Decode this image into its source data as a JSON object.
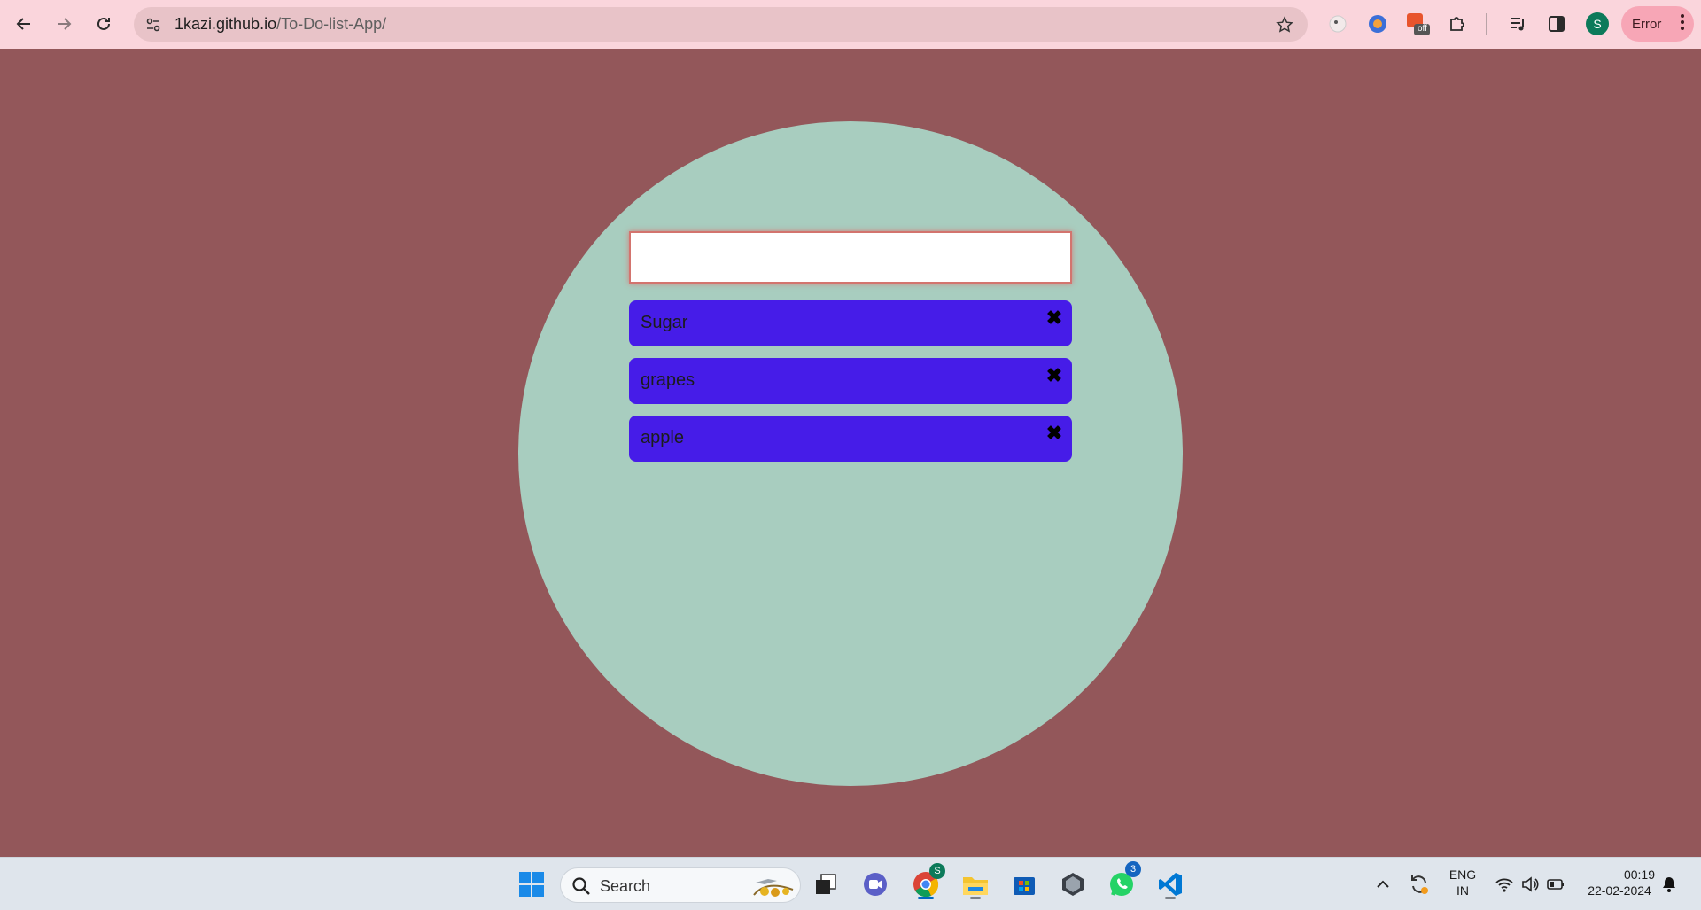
{
  "browser": {
    "url_host": "1kazi.github.io",
    "url_path": "/To-Do-list-App/",
    "profile_initial": "S",
    "error_label": "Error",
    "extensions": [
      "extension-icon",
      "chrome-extension-icon",
      "off-extension-icon",
      "puzzle-icon"
    ],
    "off_badge": "off"
  },
  "app": {
    "input": {
      "value": "",
      "placeholder": ""
    },
    "todos": [
      {
        "label": "Sugar",
        "remove_glyph": "✖"
      },
      {
        "label": "grapes",
        "remove_glyph": "✖"
      },
      {
        "label": "apple",
        "remove_glyph": "✖"
      }
    ],
    "colors": {
      "page_background": "#93575a",
      "circle": "#a8cdbf",
      "todo_item": "#461ce8",
      "input_glow": "#d3746e"
    }
  },
  "taskbar": {
    "search_label": "Search",
    "chrome_badge": "S",
    "whatsapp_badge": "3",
    "language": "ENG",
    "region": "IN",
    "time": "00:19",
    "date": "22-02-2024"
  }
}
